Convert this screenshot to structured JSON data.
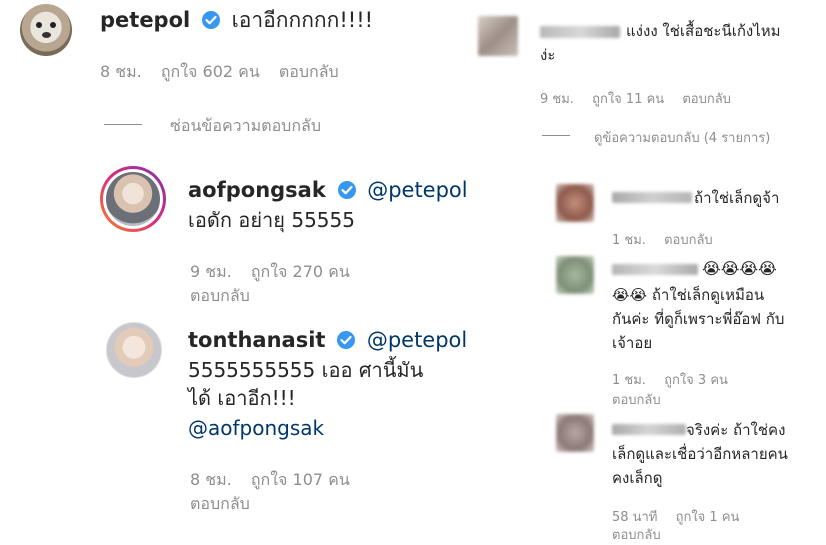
{
  "left": {
    "main_comment": {
      "username": "petepol",
      "text": "เอาอีกกกกก!!!!",
      "time": "8 ชม.",
      "likes": "ถูกใจ 602 คน",
      "reply": "ตอบกลับ"
    },
    "hide_replies": "ซ่อนข้อความตอบกลับ",
    "replies": [
      {
        "username": "aofpongsak",
        "mention": "@petepol",
        "text": "เอดัก อย่ายุ 55555",
        "time": "9 ชม.",
        "likes": "ถูกใจ 270 คน",
        "reply": "ตอบกลับ"
      },
      {
        "username": "tonthanasit",
        "mention": "@petepol",
        "text_line1": "5555555555 เออ ศานี้มัน",
        "text_line2": "ได้ เอาอีก!!!",
        "mention2": "@aofpongsak",
        "time": "8 ชม.",
        "likes": "ถูกใจ 107 คน",
        "reply": "ตอบกลับ"
      }
    ]
  },
  "right": {
    "main_comment": {
      "text_line1": "แง่งง ใช่เสื้อชะนีเก้งไหม",
      "text_line2": "ง่ะ",
      "time": "9 ชม.",
      "likes": "ถูกใจ 11 คน",
      "reply": "ตอบกลับ"
    },
    "view_replies": "ดูข้อความตอบกลับ (4 รายการ)",
    "replies": [
      {
        "text": "ถ้าใช่เล็กดูจ้า",
        "time": "1 ชม.",
        "reply": "ตอบกลับ"
      },
      {
        "emojis": "😭😭😭😭",
        "text_line1": "😭😭 ถ้าใช่เล็กดูเหมือน",
        "text_line2": "กันค่ะ ที่ดูก็เพราะพี่อ๊อฟ กับ",
        "text_line3": "เจ้าอย",
        "time": "1 ชม.",
        "likes": "ถูกใจ 3 คน",
        "reply": "ตอบกลับ"
      },
      {
        "text_line1": "จริงค่ะ ถ้าใช่คง",
        "text_line2": "เล็กดูและเชื่อว่าอีกหลายคน",
        "text_line3": "คงเล็กดู",
        "time": "58 นาที",
        "likes": "ถูกใจ 1 คน",
        "reply": "ตอบกลับ"
      }
    ]
  },
  "colors": {
    "text": "#262626",
    "meta": "#8e8e8e",
    "mention": "#00376b",
    "verified": "#3897f0",
    "story_ring_start": "#f58529",
    "story_ring_end": "#dd2a7b"
  }
}
